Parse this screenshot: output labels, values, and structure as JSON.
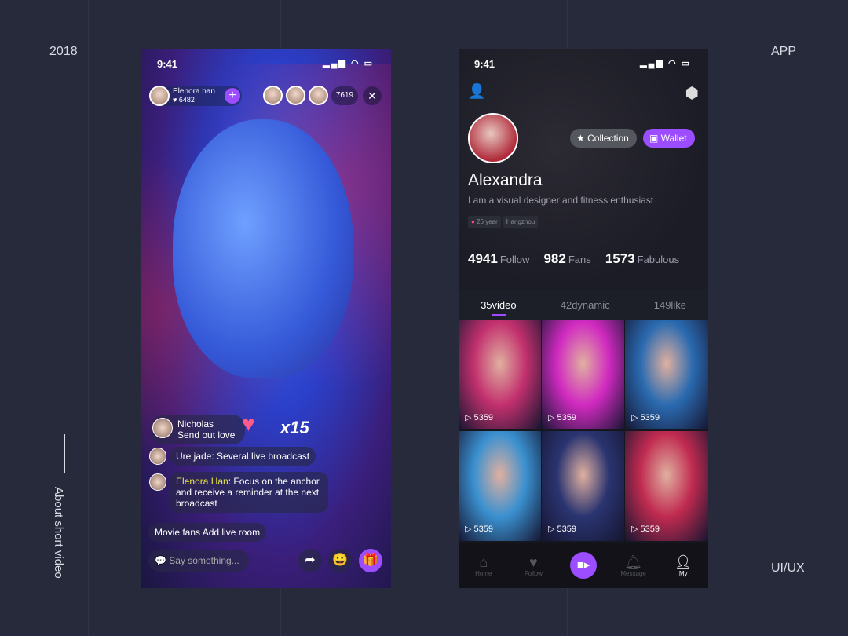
{
  "corners": {
    "year": "2018",
    "app": "APP",
    "uiux": "UI/UX",
    "side": "About short video"
  },
  "live": {
    "time": "9:41",
    "host": {
      "name": "Elenora han",
      "likes": "♥ 6482"
    },
    "viewer_count": "7619",
    "gift": {
      "sender": "Nicholas",
      "action": "Send out  love",
      "multiplier": "x15"
    },
    "messages": [
      {
        "text": "Ure jade:  Several live broadcast"
      },
      {
        "author": "Elenora Han",
        "text": ": Focus on the anchor and receive a reminder at the next broadcast"
      },
      {
        "text": "Movie fans Add live room"
      }
    ],
    "input_placeholder": "Say something..."
  },
  "profile": {
    "time": "9:41",
    "collection_label": "Collection",
    "wallet_label": "Wallet",
    "name": "Alexandra",
    "bio": "I am a visual designer and fitness enthusiast",
    "tags": [
      "26 year",
      "Hangzhou"
    ],
    "stats": [
      {
        "n": "4941",
        "l": "Follow"
      },
      {
        "n": "982",
        "l": "Fans"
      },
      {
        "n": "1573",
        "l": "Fabulous"
      }
    ],
    "tabs": [
      "35video",
      "42dynamic",
      "149like"
    ],
    "videos": [
      {
        "views": "5359",
        "c": "#c2306e"
      },
      {
        "views": "5359",
        "c": "#d02ac0"
      },
      {
        "views": "5359",
        "c": "#2a6ab0"
      },
      {
        "views": "5359",
        "c": "#3a90d0"
      },
      {
        "views": "5359",
        "c": "#2a3470"
      },
      {
        "views": "5359",
        "c": "#c02a50"
      }
    ],
    "nav": [
      "Home",
      "Follow",
      "",
      "Message",
      "My"
    ]
  },
  "colors": {
    "accent": "#9b4dff",
    "background": "#272a3b"
  }
}
